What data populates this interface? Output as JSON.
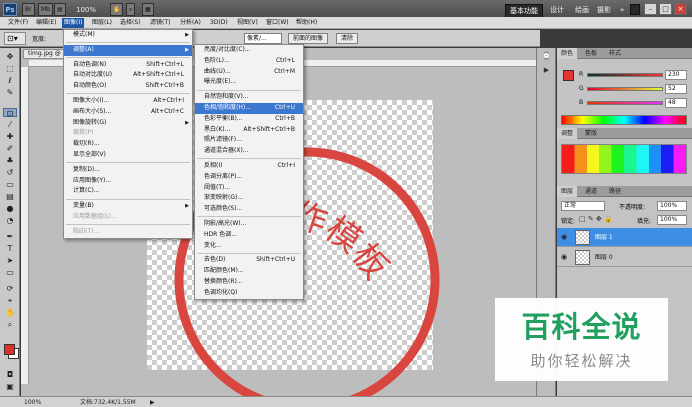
{
  "app_bar": {
    "logo": "Ps",
    "zoom": "100%",
    "workspaces": [
      "基本功能",
      "设计",
      "绘画",
      "摄影"
    ],
    "more": "»",
    "window_buttons": [
      "–",
      "□",
      "×"
    ]
  },
  "menubar": [
    "文件(F)",
    "编辑(E)",
    "图像(I)",
    "图层(L)",
    "选择(S)",
    "滤镜(T)",
    "分析(A)",
    "3D(D)",
    "视图(V)",
    "窗口(W)",
    "帮助(H)"
  ],
  "options": {
    "width_label": "宽度:",
    "unit_select": "像素/...",
    "ref_select": "参考/...",
    "front_image_button": "前面的图像",
    "clear_button": "清除"
  },
  "document": {
    "tab": "timg.jpg @"
  },
  "image_menu": [
    {
      "label": "模式(M)",
      "submenu": true
    },
    {
      "sep": true
    },
    {
      "label": "调整(A)",
      "submenu": true,
      "highlight": true
    },
    {
      "sep": true
    },
    {
      "label": "自动色调(N)",
      "shortcut": "Shift+Ctrl+L"
    },
    {
      "label": "自动对比度(U)",
      "shortcut": "Alt+Shift+Ctrl+L"
    },
    {
      "label": "自动颜色(O)",
      "shortcut": "Shift+Ctrl+B"
    },
    {
      "sep": true
    },
    {
      "label": "图像大小(I)...",
      "shortcut": "Alt+Ctrl+I"
    },
    {
      "label": "画布大小(S)...",
      "shortcut": "Alt+Ctrl+C"
    },
    {
      "label": "图像旋转(G)",
      "submenu": true
    },
    {
      "label": "裁剪(P)",
      "disabled": true
    },
    {
      "label": "裁切(R)..."
    },
    {
      "label": "显示全部(V)"
    },
    {
      "sep": true
    },
    {
      "label": "复制(D)..."
    },
    {
      "label": "应用图像(Y)..."
    },
    {
      "label": "计算(C)..."
    },
    {
      "sep": true
    },
    {
      "label": "变量(B)",
      "submenu": true
    },
    {
      "label": "应用数据组(L)...",
      "disabled": true
    },
    {
      "sep": true
    },
    {
      "label": "陷印(T)...",
      "disabled": true
    }
  ],
  "adjust_menu": [
    {
      "label": "亮度/对比度(C)..."
    },
    {
      "label": "色阶(L)...",
      "shortcut": "Ctrl+L"
    },
    {
      "label": "曲线(U)...",
      "shortcut": "Ctrl+M"
    },
    {
      "label": "曝光度(E)..."
    },
    {
      "sep": true
    },
    {
      "label": "自然饱和度(V)..."
    },
    {
      "label": "色相/饱和度(H)...",
      "shortcut": "Ctrl+U",
      "highlight": true
    },
    {
      "label": "色彩平衡(B)...",
      "shortcut": "Ctrl+B"
    },
    {
      "label": "黑白(K)...",
      "shortcut": "Alt+Shift+Ctrl+B"
    },
    {
      "label": "照片滤镜(F)..."
    },
    {
      "label": "通道混合器(X)..."
    },
    {
      "sep": true
    },
    {
      "label": "反相(I)",
      "shortcut": "Ctrl+I"
    },
    {
      "label": "色调分离(P)..."
    },
    {
      "label": "阈值(T)..."
    },
    {
      "label": "渐变映射(G)..."
    },
    {
      "label": "可选颜色(S)..."
    },
    {
      "sep": true
    },
    {
      "label": "阴影/高光(W)..."
    },
    {
      "label": "HDR 色调..."
    },
    {
      "label": "变化..."
    },
    {
      "sep": true
    },
    {
      "label": "去色(D)",
      "shortcut": "Shift+Ctrl+U"
    },
    {
      "label": "匹配颜色(M)..."
    },
    {
      "label": "替换颜色(R)..."
    },
    {
      "label": "色调均化(Q)"
    }
  ],
  "color_panel": {
    "tabs": [
      "颜色",
      "色板",
      "样式"
    ],
    "r": {
      "label": "R",
      "value": "230"
    },
    "g": {
      "label": "G",
      "value": "52"
    },
    "b": {
      "label": "B",
      "value": "48"
    }
  },
  "adjust_panel": {
    "tabs": [
      "调整",
      "蒙版"
    ]
  },
  "layers_panel": {
    "tabs": [
      "图层",
      "通道",
      "路径"
    ],
    "blend_mode": "正常",
    "opacity_label": "不透明度:",
    "opacity_value": "100%",
    "lock_label": "锁定:",
    "fill_label": "填充:",
    "fill_value": "100%",
    "layers": [
      {
        "name": "图层 1",
        "selected": true
      },
      {
        "name": "图层 0",
        "selected": false
      }
    ]
  },
  "status": {
    "zoom": "100%",
    "doc_info": "文档:732.4K/1.55M"
  },
  "stamp": {
    "text": "制作模板",
    "color": "#d9453f"
  },
  "watermark": {
    "title": "百科全说",
    "subtitle": "助你轻松解决"
  },
  "colors": {
    "menu_highlight": "#3c77d0",
    "layer_selected": "#3e8ee6",
    "foreground": "#e02f2f"
  }
}
